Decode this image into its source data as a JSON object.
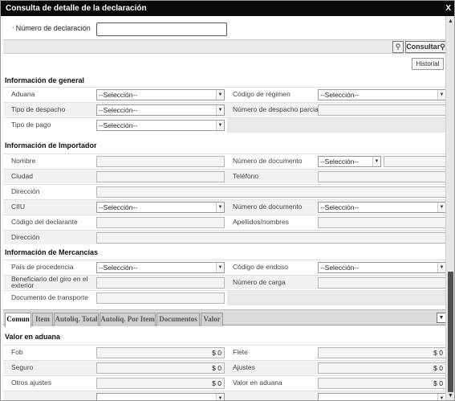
{
  "window": {
    "title": "Consulta de detalle de la declaración",
    "close": "X"
  },
  "declaracion": {
    "required_mark": "*",
    "label": "Número de declaración",
    "value": ""
  },
  "toolbar": {
    "consultar": "Consultar",
    "historial": "Historial"
  },
  "sections": {
    "general": "Información de general",
    "importador": "Información de Importador",
    "mercancias": "Información de Mercancías",
    "valor": "Valor en aduana"
  },
  "general": {
    "aduana": "Aduana",
    "codigo_regimen": "Código de régimen",
    "tipo_despacho": "Tipo de despacho",
    "numero_despacho_parcial": "Número de despacho parcial",
    "tipo_pago": "Tipo de pago"
  },
  "importador": {
    "nombre": "Nombre",
    "numero_documento": "Número de documento",
    "ciudad": "Ciudad",
    "telefono": "Teléfono",
    "direccion": "Dirección",
    "ciiu": "CIIU",
    "numero_documento2": "Número de documento",
    "codigo_declarante": "Código del declarante",
    "apellidos_nombres": "Apellidos/nombres",
    "direccion2": "Dirección"
  },
  "mercancias": {
    "pais_procedencia": "País de procedencia",
    "codigo_endoso": "Código de endoso",
    "beneficiario_giro": "Beneficiario del giro en el exterior",
    "numero_carga": "Número de carga",
    "documento_transporte": "Documento de transporte"
  },
  "select_placeholder": "--Selección--",
  "tabs": [
    "Comun",
    "Item",
    "Autoliq. Total",
    "Autoliq. Por Item",
    "Documentos",
    "Valor"
  ],
  "valor": {
    "fob": "Fob",
    "fob_val": "$ 0",
    "flete": "Flete",
    "flete_val": "$ 0",
    "seguro": "Seguro",
    "seguro_val": "$ 0",
    "ajustes": "Ajustes",
    "ajustes_val": "$ 0",
    "otros_ajustes": "Otros ajustes",
    "otros_ajustes_val": "$ 0",
    "valor_aduana": "Valor en aduana",
    "valor_aduana_val": "$ 0"
  },
  "icons": {
    "close": "close-icon",
    "search": "search-icon",
    "dropdown": "dropdown-arrow-icon"
  }
}
